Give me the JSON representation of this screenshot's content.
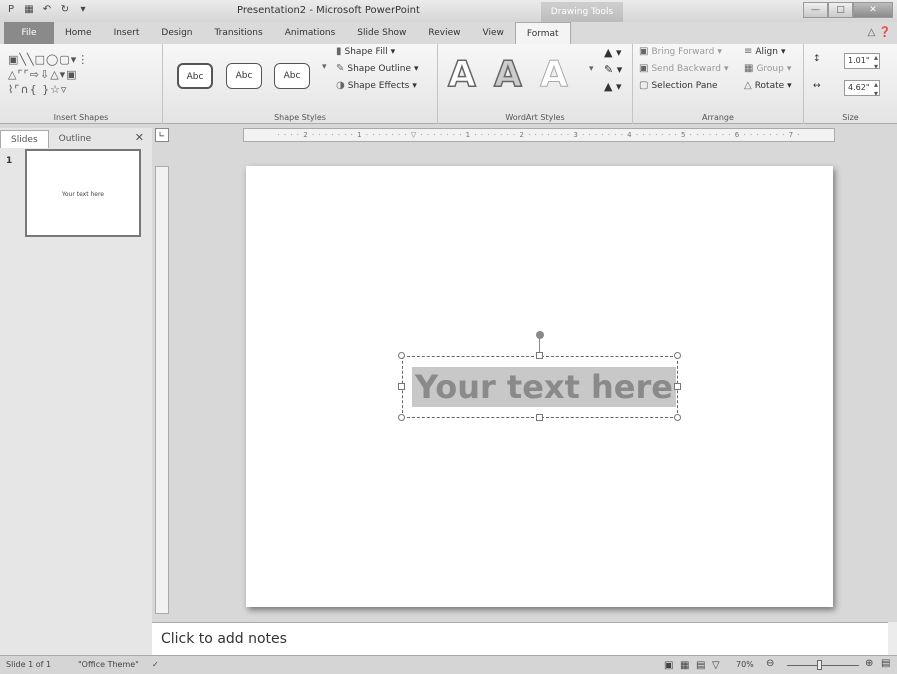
{
  "window": {
    "title": "Presentation2 - Microsoft PowerPoint",
    "contextual_tab_group": "Drawing Tools"
  },
  "tabs": [
    "File",
    "Home",
    "Insert",
    "Design",
    "Transitions",
    "Animations",
    "Slide Show",
    "Review",
    "View",
    "Format"
  ],
  "ribbon": {
    "insert_shapes_label": "Insert Shapes",
    "shape_styles": {
      "label": "Shape Styles",
      "presets": [
        "Abc",
        "Abc",
        "Abc"
      ],
      "fill": "Shape Fill",
      "outline": "Shape Outline",
      "effects": "Shape Effects"
    },
    "wordart": {
      "label": "WordArt Styles",
      "samples": [
        "A",
        "A",
        "A"
      ]
    },
    "arrange": {
      "label": "Arrange",
      "bring_forward": "Bring Forward",
      "send_backward": "Send Backward",
      "selection_pane": "Selection Pane",
      "align": "Align",
      "group": "Group",
      "rotate": "Rotate"
    },
    "size": {
      "label": "Size",
      "height": "1.01\"",
      "width": "4.62\""
    }
  },
  "left_panel": {
    "tabs": [
      "Slides",
      "Outline"
    ],
    "slide_number": "1",
    "thumbnail_text": "Your text here"
  },
  "slide": {
    "textbox_text": "Your text here"
  },
  "notes_placeholder": "Click to add notes",
  "status_bar": {
    "slide_info": "Slide 1 of 1",
    "theme": "\"Office Theme\"",
    "zoom": "70%"
  }
}
